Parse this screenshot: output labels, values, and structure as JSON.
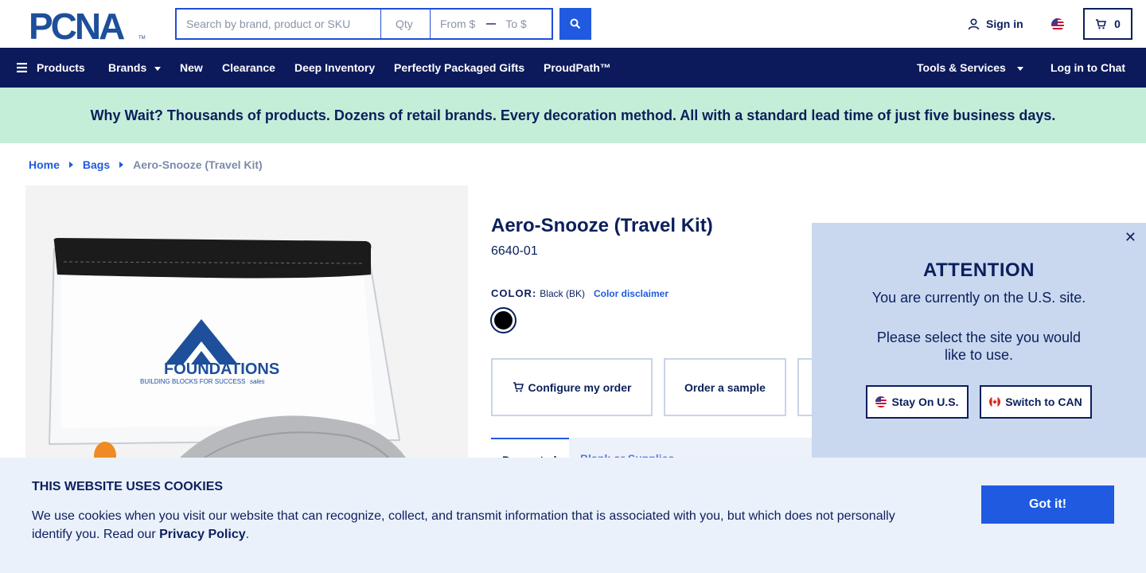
{
  "header": {
    "logo_text": "PCNA",
    "search_placeholder": "Search by brand, product or SKU",
    "qty_placeholder": "Qty",
    "from_placeholder": "From $",
    "to_placeholder": "To $",
    "sign_in": "Sign in",
    "cart_count": "0"
  },
  "nav": {
    "products": "Products",
    "brands": "Brands",
    "new": "New",
    "clearance": "Clearance",
    "deep_inventory": "Deep Inventory",
    "gifts": "Perfectly Packaged Gifts",
    "proudpath": "ProudPath™",
    "tools": "Tools & Services",
    "chat": "Log in to Chat"
  },
  "promo": "Why Wait? Thousands of products. Dozens of retail brands. Every decoration method. All with a standard lead time of just five business days.",
  "breadcrumb": {
    "home": "Home",
    "bags": "Bags",
    "current": "Aero-Snooze (Travel Kit)"
  },
  "product": {
    "title": "Aero-Snooze (Travel Kit)",
    "sku": "6640-01",
    "color_label": "COLOR:",
    "color_value": "Black (BK)",
    "color_disclaimer": "Color disclaimer",
    "swatch_color": "#000000",
    "configure": "Configure my order",
    "sample": "Order a sample",
    "tab_active": "Decorated",
    "tab_other": "Blank or Supplies",
    "image_logo_main": "FOUNDATIONS",
    "image_logo_sub": "BUILDING BLOCKS FOR SUCCESS",
    "image_logo_sub2": "sales"
  },
  "modal": {
    "title": "ATTENTION",
    "line1": "You are currently on the U.S. site.",
    "line2": "Please select the site you would like to use.",
    "stay": "Stay On U.S.",
    "switch": "Switch to CAN"
  },
  "cookie": {
    "title": "THIS WEBSITE USES COOKIES",
    "text_before": "We use cookies when you visit our website that can recognize, collect, and transmit information that is associated with you, but which does not personally identify you. Read our ",
    "link": "Privacy Policy",
    "text_after": ".",
    "button": "Got it!"
  },
  "colors": {
    "navy": "#0c1a5c",
    "accent_blue": "#1f5ae0",
    "promo_bg": "#c5eed8",
    "modal_bg": "#c9d8ef",
    "cookie_bg": "#eaf1fb"
  }
}
